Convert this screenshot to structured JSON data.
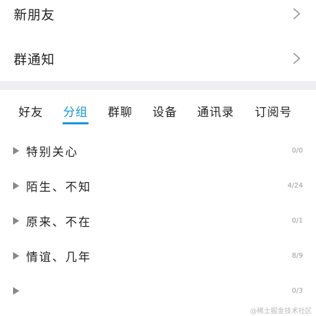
{
  "top_items": [
    {
      "label": "新朋友"
    },
    {
      "label": "群通知"
    }
  ],
  "tabs": [
    {
      "label": "好友",
      "active": false
    },
    {
      "label": "分组",
      "active": true
    },
    {
      "label": "群聊",
      "active": false
    },
    {
      "label": "设备",
      "active": false
    },
    {
      "label": "通讯录",
      "active": false
    },
    {
      "label": "订阅号",
      "active": false
    }
  ],
  "groups": [
    {
      "name": "特别关心",
      "count": "0/0"
    },
    {
      "name": "陌生、不知",
      "count": "4/24"
    },
    {
      "name": "原来、不在",
      "count": "0/1"
    },
    {
      "name": "情谊、几年",
      "count": "8/9"
    },
    {
      "name": "",
      "count": "0/3"
    }
  ],
  "watermark": "@稀土掘金技术社区",
  "colors": {
    "accent": "#1296db",
    "divider": "#efeff3",
    "text": "#222222",
    "muted": "#999999"
  },
  "icons": {
    "chevron": "chevron-right-icon",
    "expand": "triangle-right-icon"
  }
}
